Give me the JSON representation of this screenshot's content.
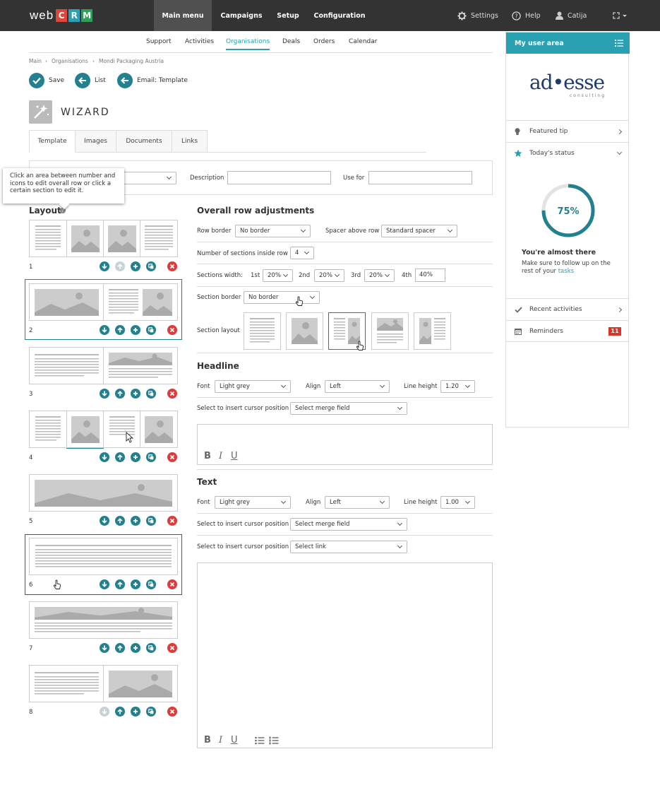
{
  "app": {
    "logo_web": "web",
    "logo_letters": [
      "C",
      "R",
      "M"
    ],
    "logo_colors": [
      "#e0453a",
      "#2aa0b3",
      "#2f9e5a"
    ]
  },
  "topnav": {
    "items": [
      "Main menu",
      "Campaigns",
      "Setup",
      "Configuration"
    ],
    "active": "Main menu",
    "settings": "Settings",
    "help": "Help",
    "user": "Catija"
  },
  "subnav": {
    "items": [
      "Support",
      "Activities",
      "Organisations",
      "Deals",
      "Orders",
      "Calendar"
    ],
    "active": "Organisations"
  },
  "breadcrumb": [
    "Main",
    "Organisations",
    "Mondi Packaging Austria"
  ],
  "actions": {
    "save": "Save",
    "list": "List",
    "email_template": "Email: Template"
  },
  "page": {
    "title": "WIZARD",
    "tabs": [
      "Template",
      "Images",
      "Documents",
      "Links"
    ],
    "active_tab": "Template"
  },
  "form": {
    "description_label": "Description",
    "use_for_label": "Use for",
    "description_value": "",
    "use_for_value": ""
  },
  "tooltip": "Click an area between number and icons to edit overall row or click a certain section to edit it.",
  "layout": {
    "heading": "Layout",
    "rows": [
      "1",
      "2",
      "3",
      "4",
      "5",
      "6",
      "7",
      "8"
    ]
  },
  "overall": {
    "heading": "Overall row adjustments",
    "row_border_label": "Row border",
    "row_border_value": "No border",
    "spacer_label": "Spacer above row",
    "spacer_value": "Standard spacer",
    "sections_count_label": "Number of sections inside row",
    "sections_count_value": "4",
    "sections_width_label": "Sections width:",
    "widths": [
      {
        "label": "1st",
        "value": "20%"
      },
      {
        "label": "2nd",
        "value": "20%"
      },
      {
        "label": "3rd",
        "value": "20%"
      },
      {
        "label": "4th",
        "value": "40%"
      }
    ],
    "section_border_label": "Section border",
    "section_border_value": "No border",
    "section_layout_label": "Section layout"
  },
  "headline": {
    "heading": "Headline",
    "font_label": "Font",
    "font_value": "Light grey",
    "align_label": "Align",
    "align_value": "Left",
    "line_height_label": "Line height",
    "line_height_value": "1.20",
    "cursor_label": "Select to insert cursor position",
    "merge_value": "Select merge field"
  },
  "text": {
    "heading": "Text",
    "font_label": "Font",
    "font_value": "Light grey",
    "align_label": "Align",
    "align_value": "Left",
    "line_height_label": "Line height",
    "line_height_value": "1.00",
    "cursor_label": "Select to insert cursor position",
    "merge_value": "Select merge field",
    "cursor_label_2": "Select to insert cursor position",
    "link_value": "Select link"
  },
  "editor_buttons": {
    "bold": "B",
    "italic": "I",
    "underline": "U"
  },
  "user_area": {
    "heading": "My user area",
    "company_logo_text": "ad•esse",
    "company_logo_sub": "consulting",
    "featured_tip": "Featured tip",
    "todays_status": "Today's status",
    "progress_percent": 75,
    "progress_label": "75%",
    "almost_there": "You're almost there",
    "follow_up_text": "Make sure to follow up on the rest of your",
    "tasks_link": "tasks",
    "recent_activities": "Recent activities",
    "reminders": "Reminders",
    "reminders_count": "11",
    "accent_color": "#2aa0b3",
    "badge_color": "#d9362b"
  }
}
